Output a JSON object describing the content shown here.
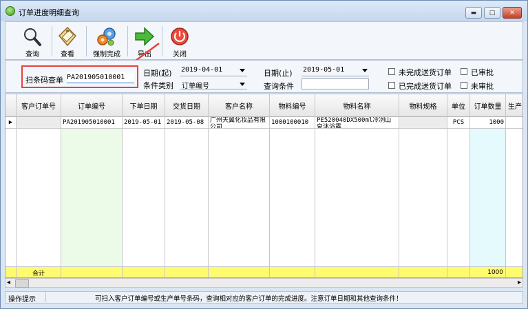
{
  "window": {
    "title": "订单进度明细查询",
    "controls": {
      "minimize": "▬",
      "maximize": "□",
      "close": "✕"
    }
  },
  "toolbar": {
    "buttons": [
      {
        "label": "查询",
        "icon": "magnifier-icon"
      },
      {
        "label": "查看",
        "icon": "tag-icon"
      },
      {
        "label": "强制完成",
        "icon": "gears-icon"
      },
      {
        "label": "导出",
        "icon": "green-arrow-icon"
      },
      {
        "label": "关闭",
        "icon": "power-icon"
      }
    ]
  },
  "filter": {
    "scan_label": "扫条码查单",
    "scan_value": "PA201905010001",
    "date_from_label": "日期(起)",
    "date_from": "2019-04-01",
    "date_to_label": "日期(止)",
    "date_to": "2019-05-01",
    "condition_type_label": "条件类别",
    "condition_type": "订单编号",
    "condition_label": "查询条件",
    "condition_value": "",
    "checkboxes": [
      {
        "label": "未完成送货订单",
        "checked": false
      },
      {
        "label": "已审批",
        "checked": false
      },
      {
        "label": "已完成送货订单",
        "checked": false
      },
      {
        "label": "未审批",
        "checked": false
      }
    ]
  },
  "grid": {
    "columns": [
      "客户订单号",
      "订单编号",
      "下单日期",
      "交货日期",
      "客户名称",
      "物料编号",
      "物料名称",
      "物料规格",
      "单位",
      "订单数量",
      "生产"
    ],
    "row_indicator": "▶",
    "rows": [
      {
        "customer_order_no": "",
        "order_no": "PA201905010001",
        "order_date": "2019-05-01",
        "delivery_date": "2019-05-08",
        "customer_name": "广州天翼化妆品有限公司",
        "material_no": "1000100010",
        "material_name": "PE520040DX500ml冷冽山泉沐浴露",
        "material_spec": "",
        "unit": "PCS",
        "order_qty": "1000"
      }
    ],
    "footer": {
      "label": "合计",
      "order_qty": "1000"
    }
  },
  "scrollbar": {
    "left_arrow": "◂",
    "right_arrow": "▸"
  },
  "status": {
    "label": "操作提示",
    "message": "可扫入客户订单编号或生产单号条码，查询相对应的客户订单的完成进度。注意订单日期和其他查询条件！"
  },
  "colors": {
    "highlight_box": "#e8413a",
    "order_no_column": "#ecfbe8",
    "qty_column": "#e4fafc",
    "footer_row": "#fefb6f"
  }
}
